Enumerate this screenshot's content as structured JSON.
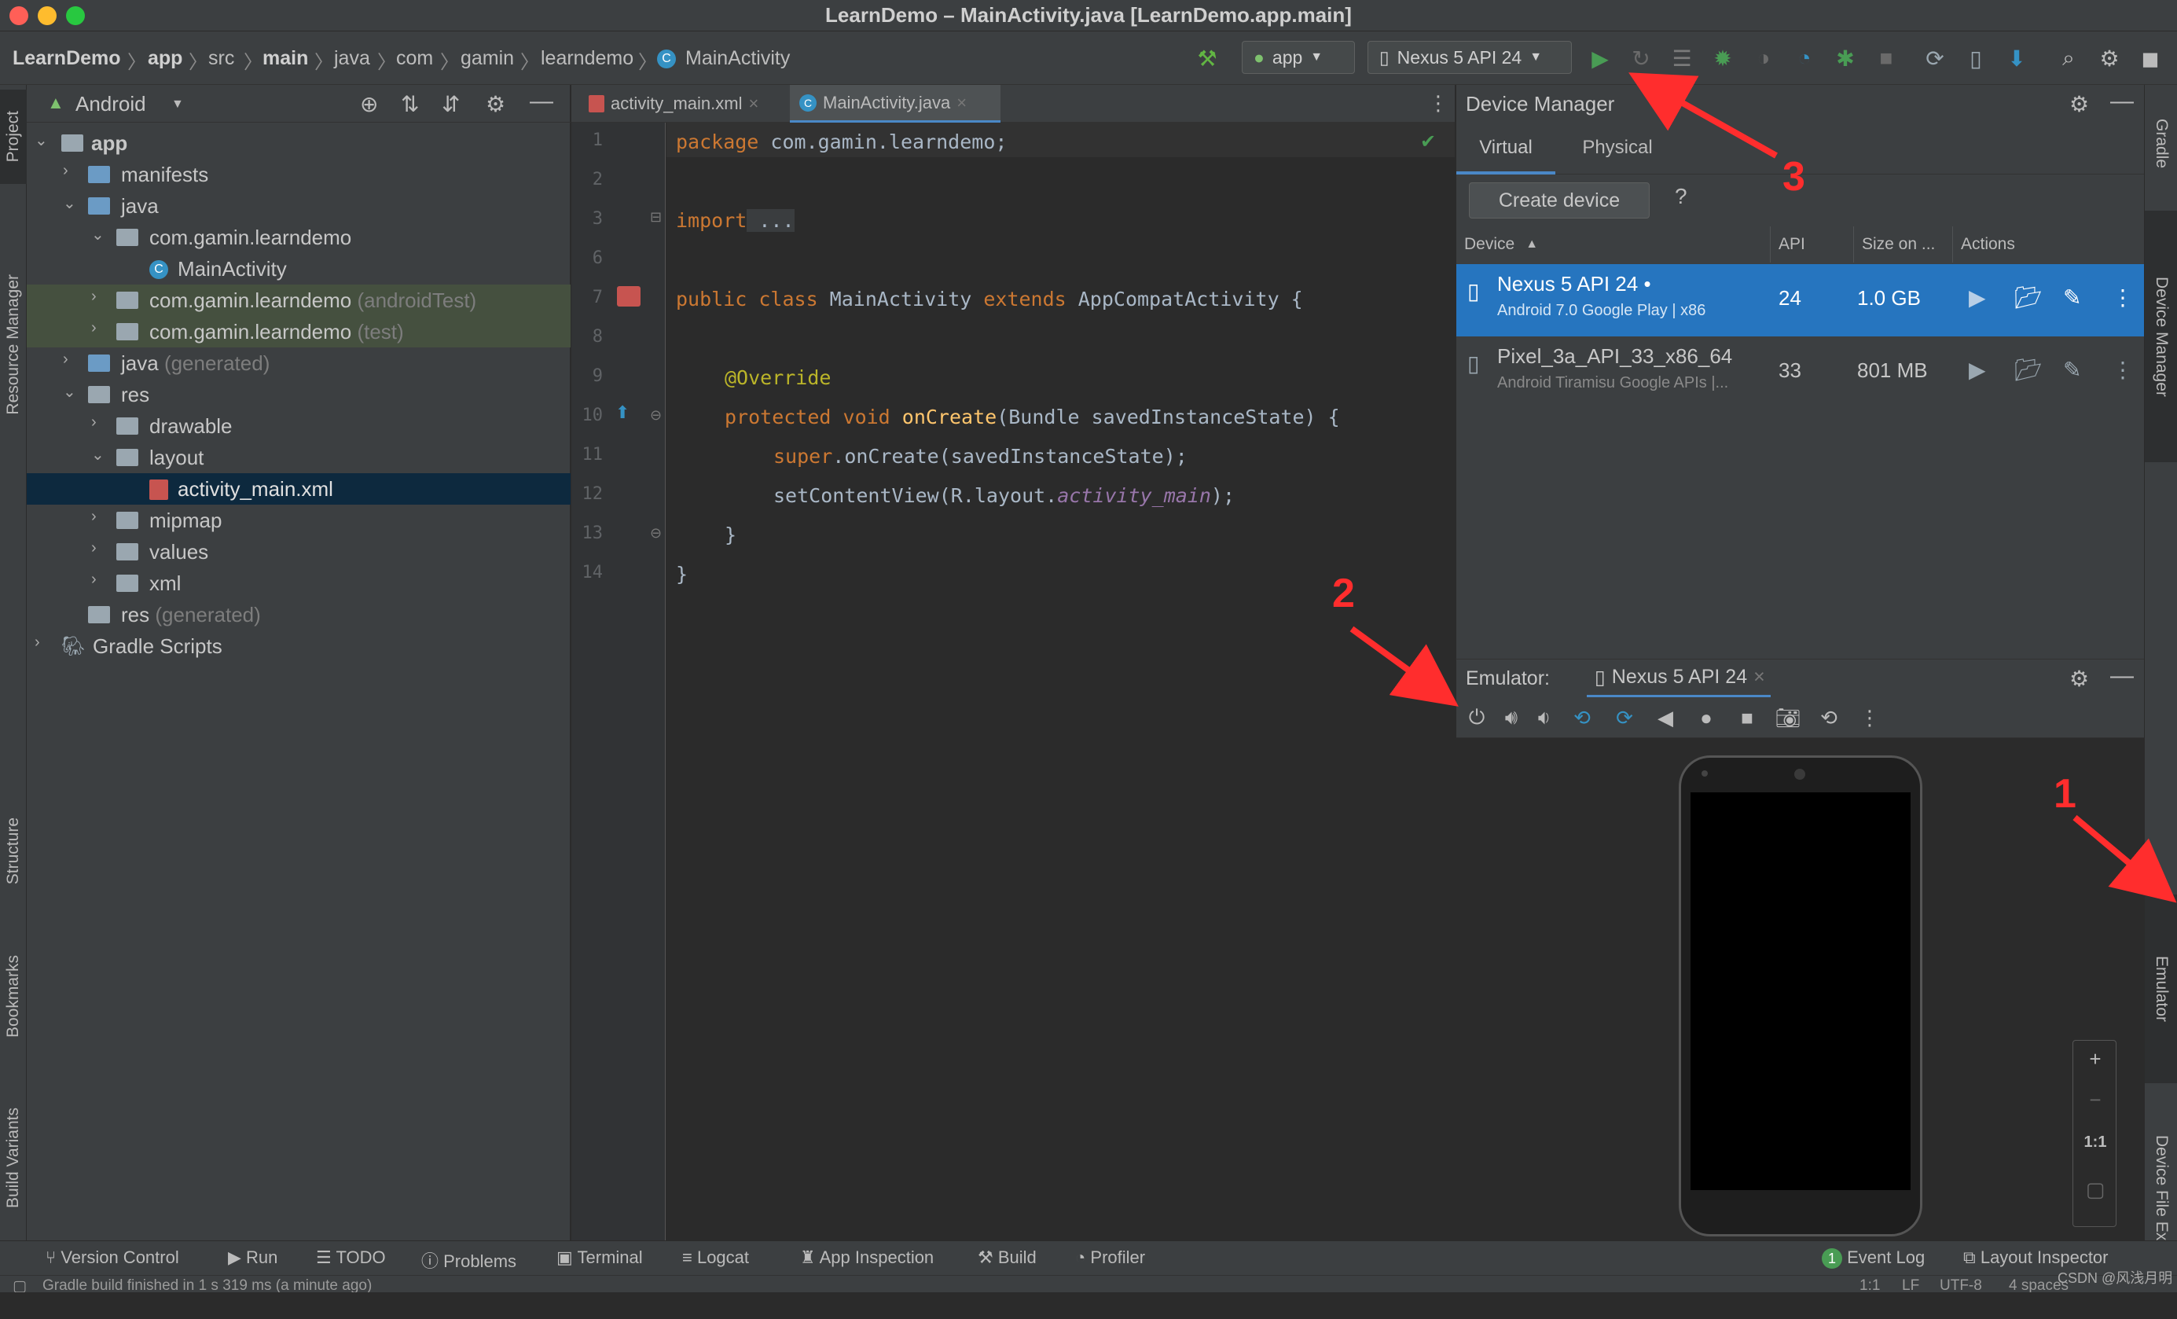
{
  "window": {
    "title": "LearnDemo – MainActivity.java [LearnDemo.app.main]"
  },
  "breadcrumb": [
    "LearnDemo",
    "app",
    "src",
    "main",
    "java",
    "com",
    "gamin",
    "learndemo",
    "MainActivity"
  ],
  "toolbar": {
    "run_config": "app",
    "device": "Nexus 5 API 24"
  },
  "left_strip": [
    "Project",
    "Resource Manager",
    "Structure",
    "Bookmarks",
    "Build Variants"
  ],
  "right_strip": [
    "Gradle",
    "Device Manager",
    "Emulator",
    "Device File Explorer"
  ],
  "project": {
    "view_mode": "Android",
    "tree": [
      {
        "label": "app",
        "bold": true
      },
      {
        "label": "manifests"
      },
      {
        "label": "java"
      },
      {
        "label": "com.gamin.learndemo"
      },
      {
        "label": "MainActivity"
      },
      {
        "label": "com.gamin.learndemo",
        "suffix": "(androidTest)"
      },
      {
        "label": "com.gamin.learndemo",
        "suffix": "(test)"
      },
      {
        "label": "java",
        "suffix": "(generated)"
      },
      {
        "label": "res"
      },
      {
        "label": "drawable"
      },
      {
        "label": "layout"
      },
      {
        "label": "activity_main.xml"
      },
      {
        "label": "mipmap"
      },
      {
        "label": "values"
      },
      {
        "label": "xml"
      },
      {
        "label": "res",
        "suffix": "(generated)"
      },
      {
        "label": "Gradle Scripts"
      }
    ]
  },
  "editor": {
    "tabs": [
      "activity_main.xml",
      "MainActivity.java"
    ],
    "line_numbers": [
      "1",
      "2",
      "3",
      "6",
      "7",
      "8",
      "9",
      "10",
      "11",
      "12",
      "13",
      "14"
    ],
    "code": {
      "l1_kw": "package",
      "l1_rest": " com.gamin.learndemo;",
      "l3_kw": "import",
      "l3_rest": " ...",
      "l7_kw1": "public class",
      "l7_name": " MainActivity ",
      "l7_kw2": "extends",
      "l7_rest": " AppCompatActivity {",
      "l9_ann": "@Override",
      "l10_kw": "protected void",
      "l10_fn": " onCreate",
      "l10_rest": "(Bundle savedInstanceState) {",
      "l11_kw": "super",
      "l11_rest": ".onCreate(savedInstanceState);",
      "l12_a": "setContentView(R.layout.",
      "l12_it": "activity_main",
      "l12_b": ");",
      "l13": "}",
      "l14": "}"
    }
  },
  "device_manager": {
    "title": "Device Manager",
    "tabs": [
      "Virtual",
      "Physical"
    ],
    "create_button": "Create device",
    "help": "?",
    "columns": [
      "Device",
      "API",
      "Size on ...",
      "Actions"
    ],
    "devices": [
      {
        "name": "Nexus 5 API 24",
        "sub": "Android 7.0 Google Play | x86",
        "api": "24",
        "size": "1.0 GB",
        "dot": "•"
      },
      {
        "name": "Pixel_3a_API_33_x86_64",
        "sub": "Android Tiramisu Google APIs |...",
        "api": "33",
        "size": "801 MB"
      }
    ]
  },
  "emulator": {
    "label": "Emulator:",
    "device": "Nexus 5 API 24",
    "zoom_ratio": "1:1"
  },
  "annotations": [
    "1",
    "2",
    "3"
  ],
  "bottom_tools": [
    "Version Control",
    "Run",
    "TODO",
    "Problems",
    "Terminal",
    "Logcat",
    "App Inspection",
    "Build",
    "Profiler",
    "Event Log",
    "Layout Inspector"
  ],
  "event_badge": "1",
  "status": {
    "message": "Gradle build finished in 1 s 319 ms (a minute ago)",
    "position": "1:1",
    "line_sep": "LF",
    "encoding": "UTF-8",
    "indent": "4 spaces"
  },
  "watermark": "CSDN @风浅月明",
  "colors": {
    "accent": "#2675bf",
    "run_green": "#499c54",
    "annotation_red": "#ff2d2d"
  }
}
